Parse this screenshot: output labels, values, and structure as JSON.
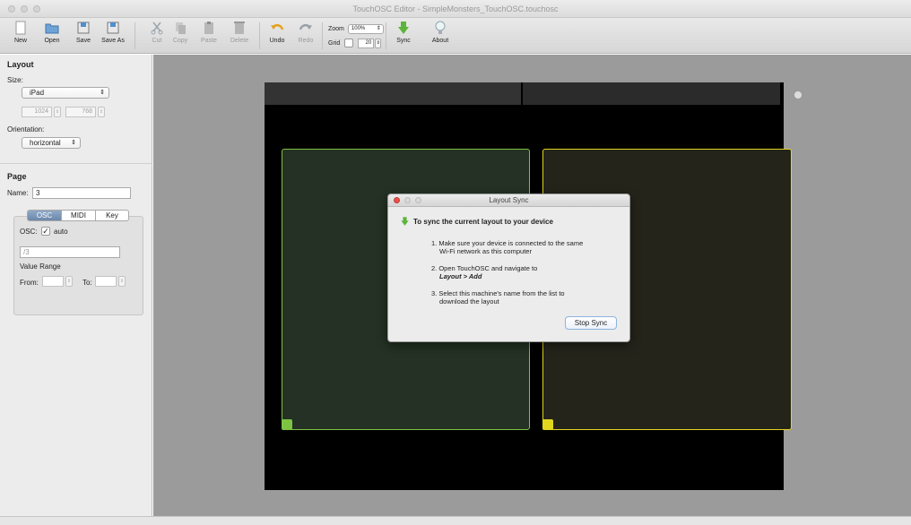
{
  "window": {
    "title": "TouchOSC Editor - SimpleMonsters_TouchOSC.touchosc"
  },
  "toolbar": {
    "new": "New",
    "open": "Open",
    "save": "Save",
    "save_as": "Save As",
    "cut": "Cut",
    "copy": "Copy",
    "paste": "Paste",
    "delete": "Delete",
    "undo": "Undo",
    "redo": "Redo",
    "zoom_label": "Zoom",
    "zoom_value": "100%",
    "grid_label": "Grid",
    "grid_value": "20",
    "sync": "Sync",
    "about": "About"
  },
  "layout": {
    "title": "Layout",
    "size_label": "Size:",
    "size_value": "iPad",
    "width": "1024",
    "height": "768",
    "orientation_label": "Orientation:",
    "orientation_value": "horizontal"
  },
  "page": {
    "title": "Page",
    "name_label": "Name:",
    "name_value": "3",
    "tabs": [
      "OSC",
      "MIDI",
      "Key"
    ],
    "osc_label": "OSC:",
    "auto_label": "auto",
    "address_value": "/3",
    "value_range_label": "Value Range",
    "from_label": "From:",
    "to_label": "To:"
  },
  "dialog": {
    "title": "Layout Sync",
    "heading": "To sync the current layout to your device",
    "step1": "1. Make sure your device is connected to the same",
    "step1b": "Wi-Fi network as this computer",
    "step2": "2. Open TouchOSC and navigate to",
    "step2b": "Layout > Add",
    "step3": "3. Select this machine's name from the list to",
    "step3b": "download the layout",
    "button": "Stop Sync"
  },
  "colors": {
    "pad_green": "#7ec242",
    "pad_yellow": "#e2d51e",
    "accent": "#6b87aa"
  }
}
